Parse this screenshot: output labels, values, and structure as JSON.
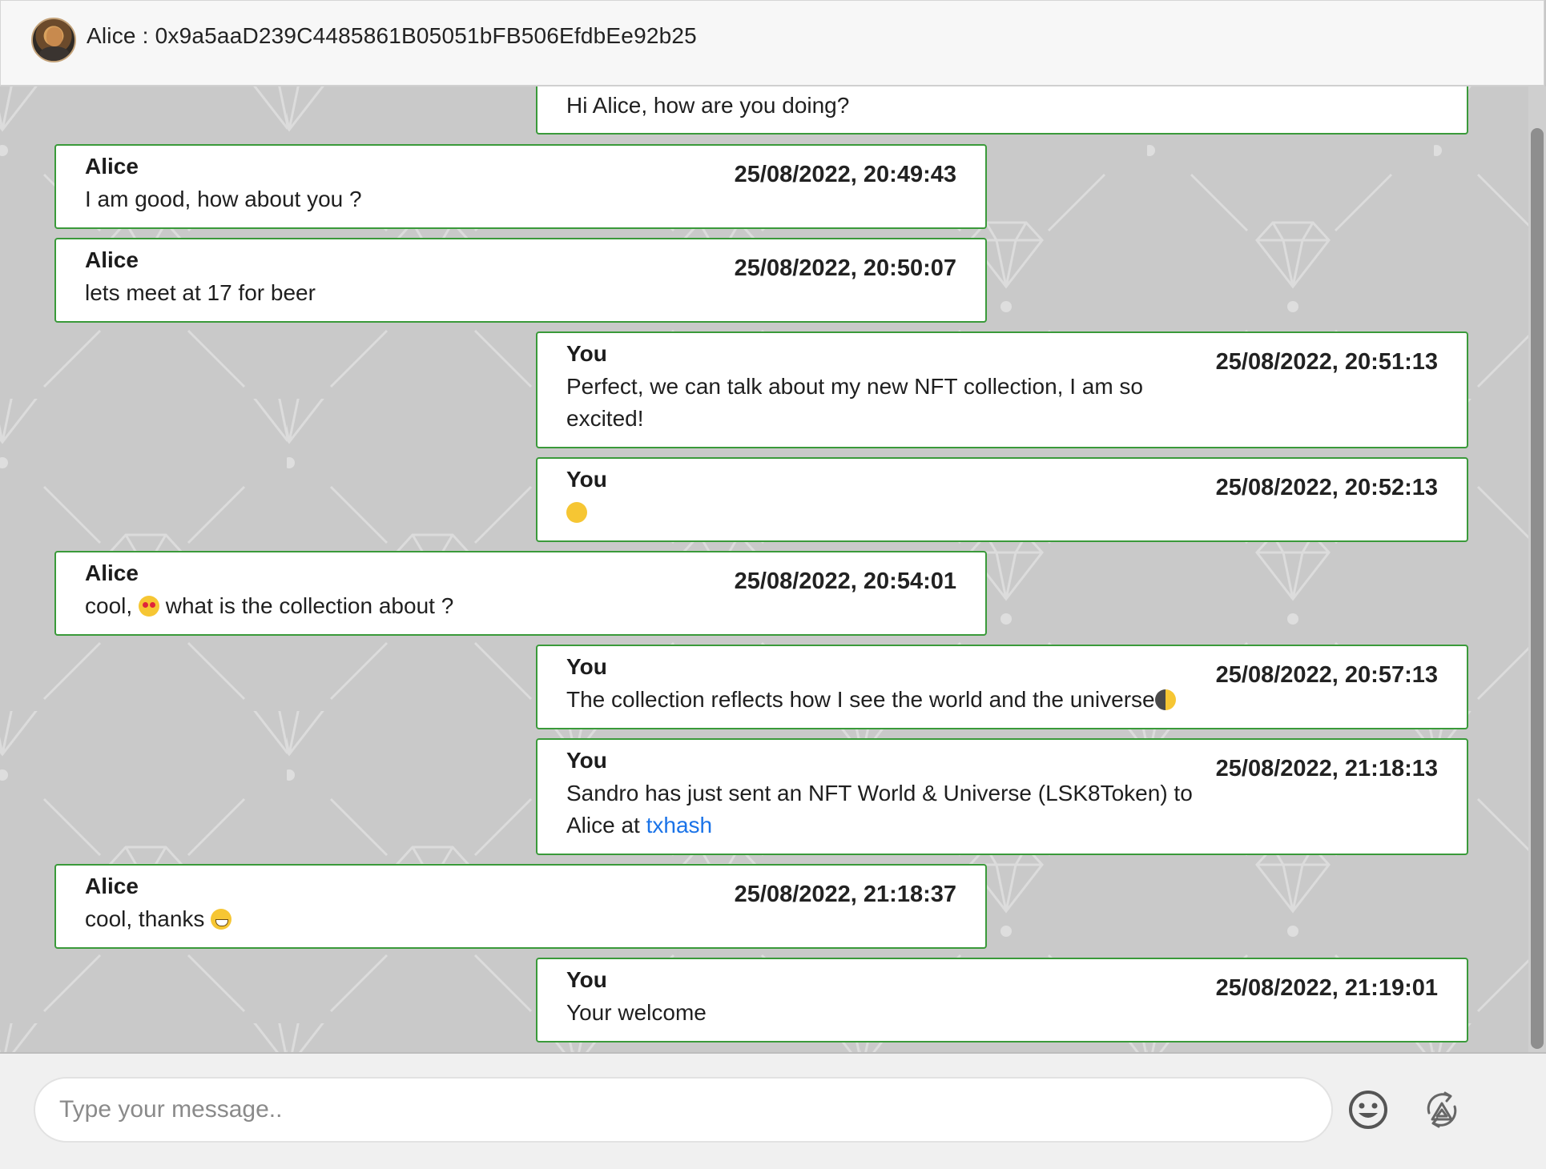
{
  "header": {
    "title": "Alice : 0x9a5aaD239C4485861B05051bFB506EfdbEe92b25"
  },
  "messages": [
    {
      "sender": "",
      "time": "",
      "text": "Hi Alice, how are you doing?",
      "side": "right"
    },
    {
      "sender": "Alice",
      "time": "25/08/2022, 20:49:43",
      "text": "I am good, how about you ?",
      "side": "left"
    },
    {
      "sender": "Alice",
      "time": "25/08/2022, 20:50:07",
      "text": "lets meet at 17 for beer",
      "side": "left"
    },
    {
      "sender": "You",
      "time": "25/08/2022, 20:51:13",
      "text_line1": "Perfect, we can talk about my new NFT collection, I am so",
      "text_line2": "excited!",
      "side": "right"
    },
    {
      "sender": "You",
      "time": "25/08/2022, 20:52:13",
      "emoji": "partying-face-icon",
      "side": "right"
    },
    {
      "sender": "Alice",
      "time": "25/08/2022, 20:54:01",
      "text_before": "cool, ",
      "emoji": "heart-eyes-icon",
      "text_after": " what is the collection about ?",
      "side": "left"
    },
    {
      "sender": "You",
      "time": "25/08/2022, 20:57:13",
      "text": "The collection reflects how I see the world and the universe",
      "emoji": "moon-icon",
      "side": "right"
    },
    {
      "sender": "You",
      "time": "25/08/2022, 21:18:13",
      "text_line1": "Sandro has just sent an NFT World & Universe (LSK8Token) to",
      "text_line2": "Alice at ",
      "link": "txhash",
      "side": "right"
    },
    {
      "sender": "Alice",
      "time": "25/08/2022, 21:18:37",
      "text": "cool, thanks ",
      "emoji": "grinning-face-icon",
      "side": "left"
    },
    {
      "sender": "You",
      "time": "25/08/2022, 21:19:01",
      "text": "Your welcome",
      "side": "right"
    }
  ],
  "composer": {
    "placeholder": "Type your message..",
    "value": "",
    "emoji_button_icon": "smiley-icon",
    "nft_button_icon": "nft-transfer-icon"
  },
  "colors": {
    "bubble_border": "#3a9a3a",
    "background": "#c9c9c9",
    "link": "#1a73e8"
  }
}
